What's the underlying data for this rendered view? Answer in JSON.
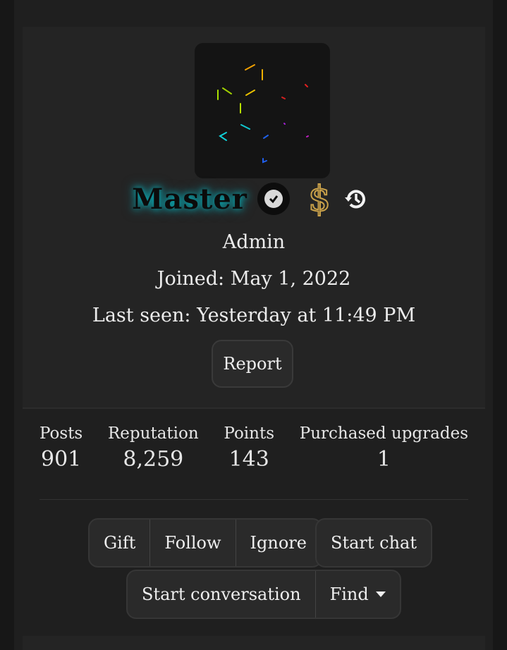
{
  "profile": {
    "username": "Master",
    "role": "Admin",
    "joined": "Joined: May 1, 2022",
    "last_seen": "Last seen: Yesterday at 11:49 PM",
    "report_label": "Report"
  },
  "icons": {
    "verified": "check-circle-icon",
    "upgrade": "dollar-icon",
    "history": "history-icon"
  },
  "stats": [
    {
      "label": "Posts",
      "value": "901"
    },
    {
      "label": "Reputation",
      "value": "8,259"
    },
    {
      "label": "Points",
      "value": "143"
    },
    {
      "label": "Purchased upgrades",
      "value": "1"
    }
  ],
  "actions": {
    "gift": "Gift",
    "follow": "Follow",
    "ignore": "Ignore",
    "start_chat": "Start chat",
    "start_conversation": "Start conversation",
    "find": "Find"
  },
  "colors": {
    "username_glow": "#00dce6",
    "dollar": "#c9a14a"
  }
}
